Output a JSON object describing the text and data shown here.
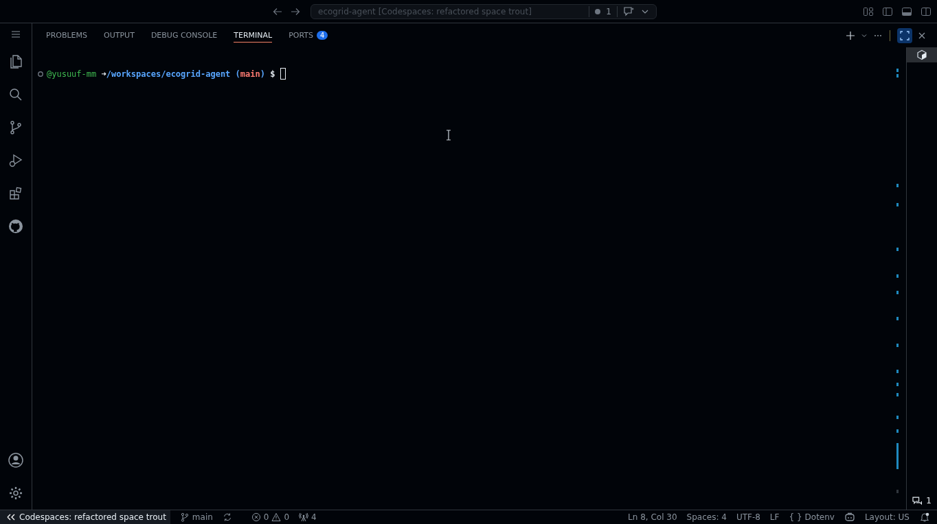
{
  "title_bar": {
    "command_center": "ecogrid-agent [Codespaces: refactored space trout]",
    "problems_count": "1"
  },
  "panel_tabs": [
    {
      "label": "PROBLEMS",
      "selected": false
    },
    {
      "label": "OUTPUT",
      "selected": false
    },
    {
      "label": "DEBUG CONSOLE",
      "selected": false
    },
    {
      "label": "TERMINAL",
      "selected": true
    },
    {
      "label": "PORTS",
      "selected": false,
      "badge": "4"
    }
  ],
  "terminal": {
    "user": "@yusuuf-mm",
    "arrow": "➜",
    "path": "/workspaces/ecogrid-agent",
    "branch_open": "(",
    "branch": "main",
    "branch_close": ")",
    "prompt": "$"
  },
  "chat_count": "1",
  "status_bar": {
    "remote": "Codespaces: refactored space trout",
    "branch": "main",
    "errors": "0",
    "warnings": "0",
    "ports": "4",
    "position": "Ln 8, Col 30",
    "spaces": "Spaces: 4",
    "encoding": "UTF-8",
    "eol": "LF",
    "language_braces": "{ }",
    "language": "Dotenv",
    "layout": "Layout: US"
  }
}
